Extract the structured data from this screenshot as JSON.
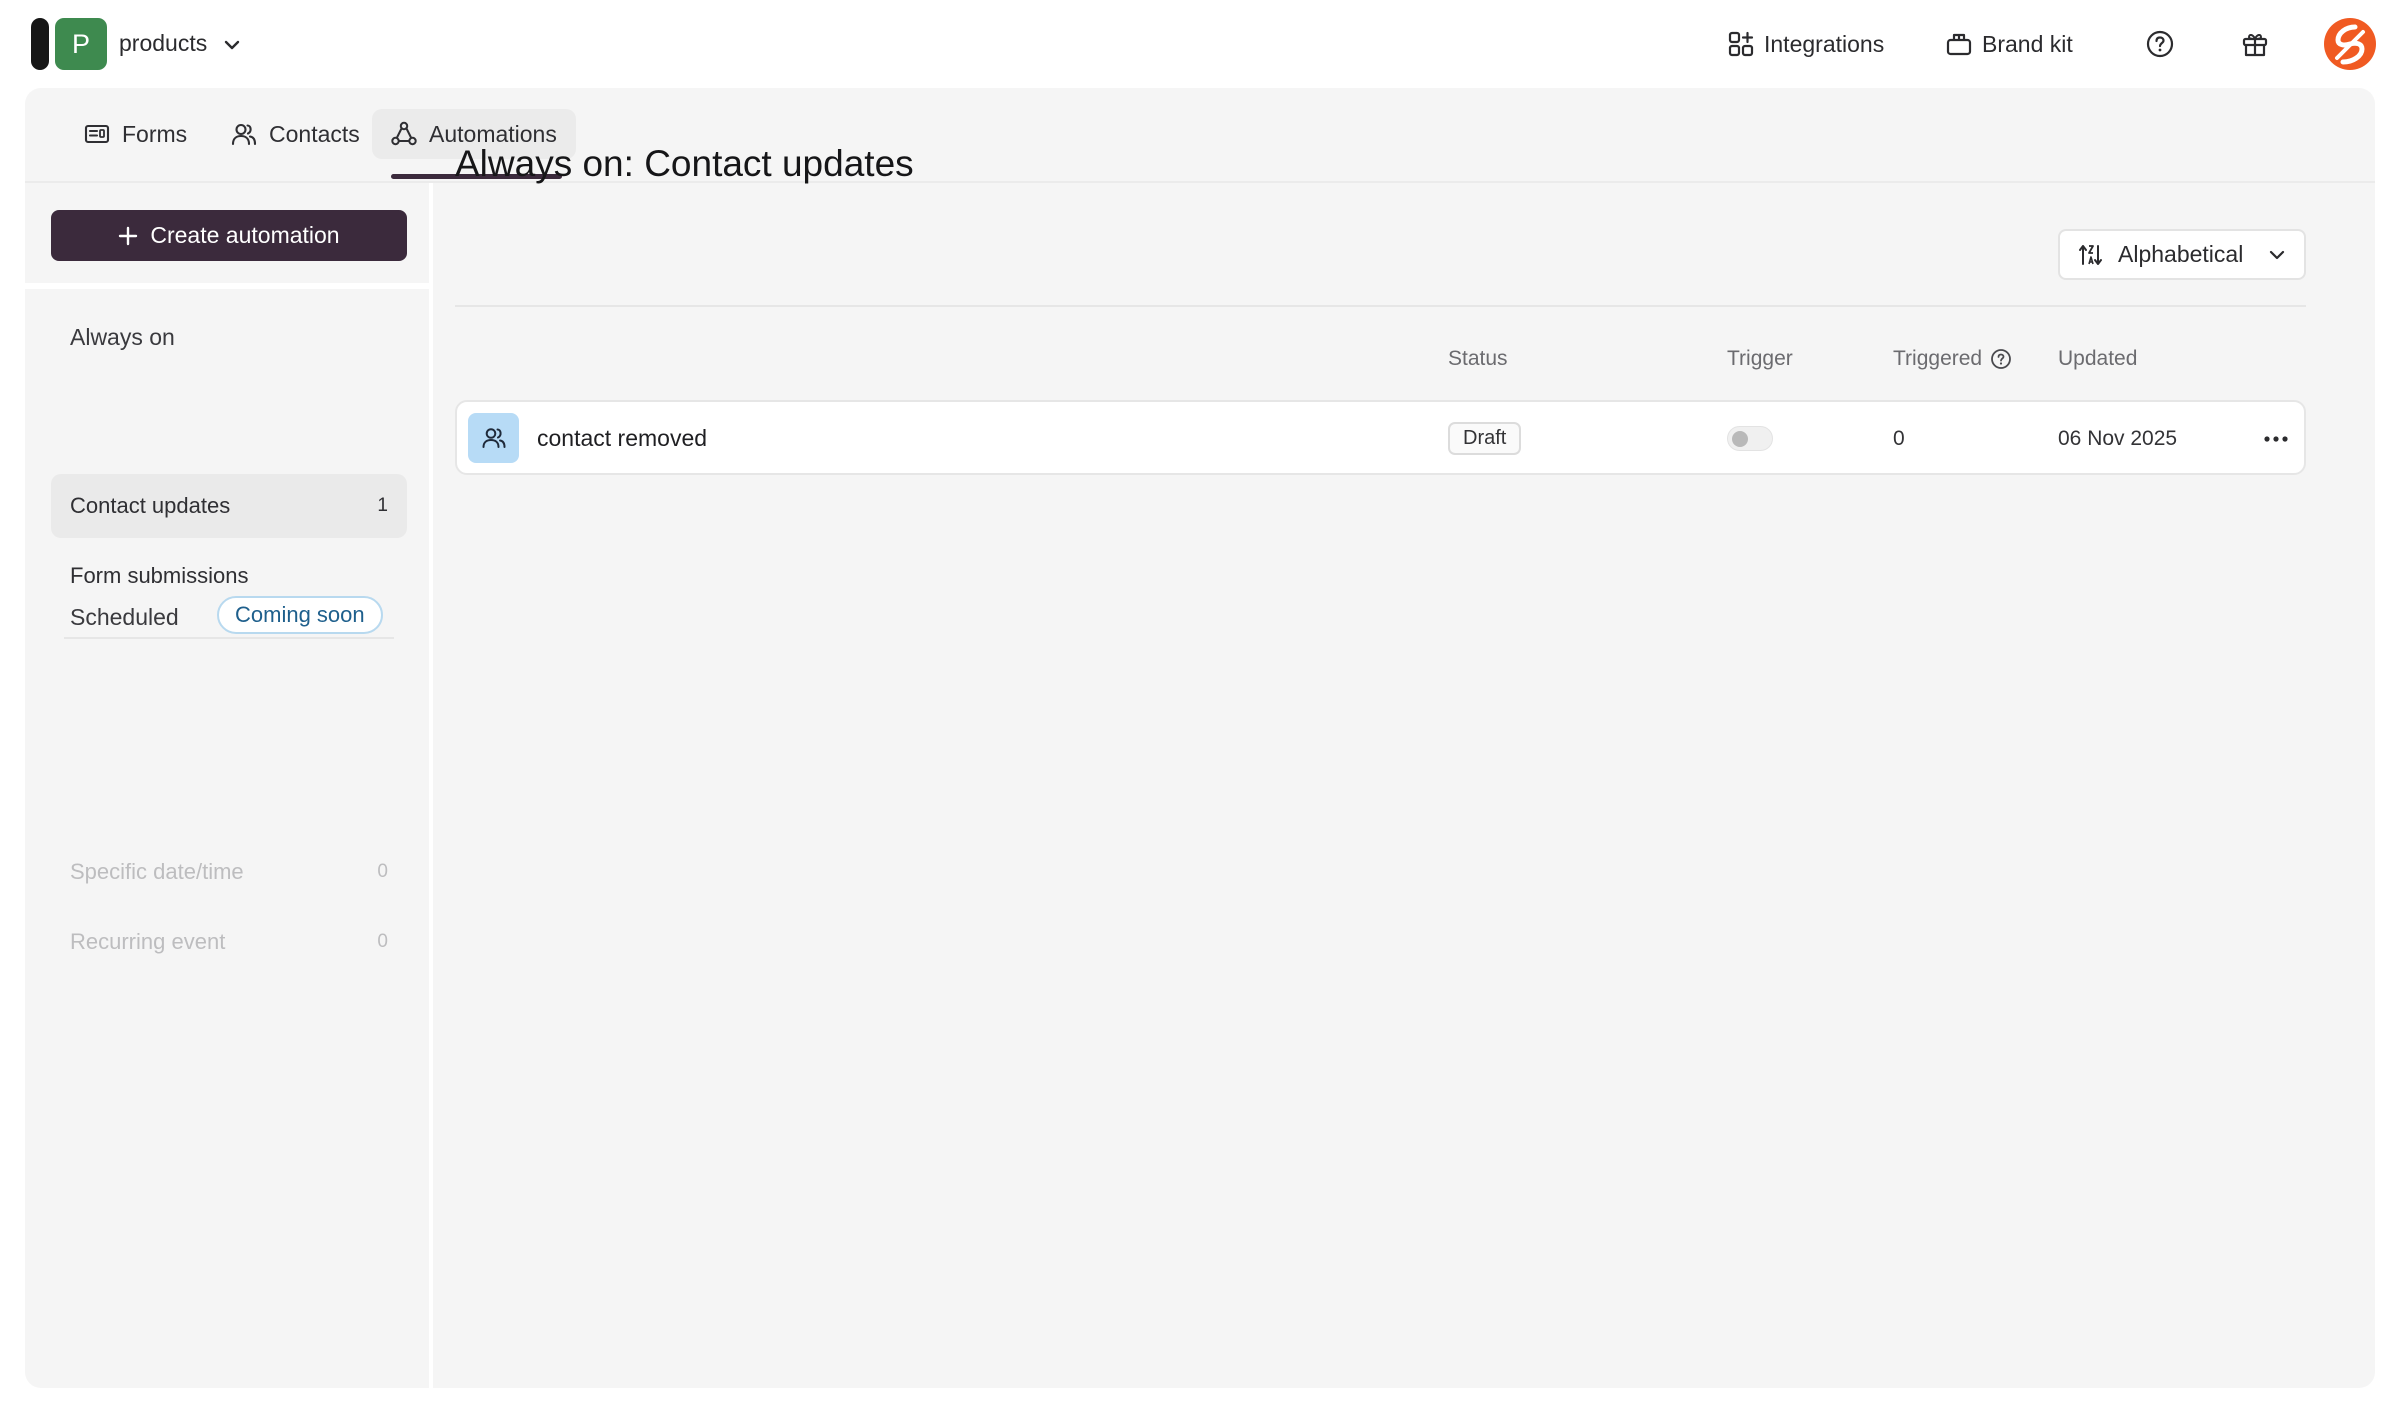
{
  "workspace": {
    "initial": "P",
    "name": "products"
  },
  "topbar": {
    "integrations_label": "Integrations",
    "brandkit_label": "Brand kit"
  },
  "tabs": [
    {
      "label": "Forms"
    },
    {
      "label": "Contacts"
    },
    {
      "label": "Automations"
    }
  ],
  "sidebar": {
    "create_label": "Create automation",
    "always_on_heading": "Always on",
    "always_on_items": [
      {
        "label": "Contact updates",
        "count": "1"
      },
      {
        "label": "Form submissions",
        "count": ""
      }
    ],
    "scheduled_heading": "Scheduled",
    "scheduled_badge": "Coming soon",
    "scheduled_items": [
      {
        "label": "Specific date/time",
        "count": "0"
      },
      {
        "label": "Recurring event",
        "count": "0"
      }
    ]
  },
  "main": {
    "title": "Always on: Contact updates",
    "sort_label": "Alphabetical",
    "columns": {
      "status": "Status",
      "trigger": "Trigger",
      "triggered": "Triggered",
      "updated": "Updated"
    },
    "rows": [
      {
        "name": "contact removed",
        "status": "Draft",
        "trigger_enabled": false,
        "triggered": "0",
        "updated": "06 Nov 2025"
      }
    ]
  },
  "colors": {
    "primary": "#3b2a3c",
    "workspace_avatar": "#3e8a4f",
    "user_avatar": "#f05a22",
    "badge_border": "#b8d9ef",
    "row_icon_bg": "#b7dbf6"
  }
}
